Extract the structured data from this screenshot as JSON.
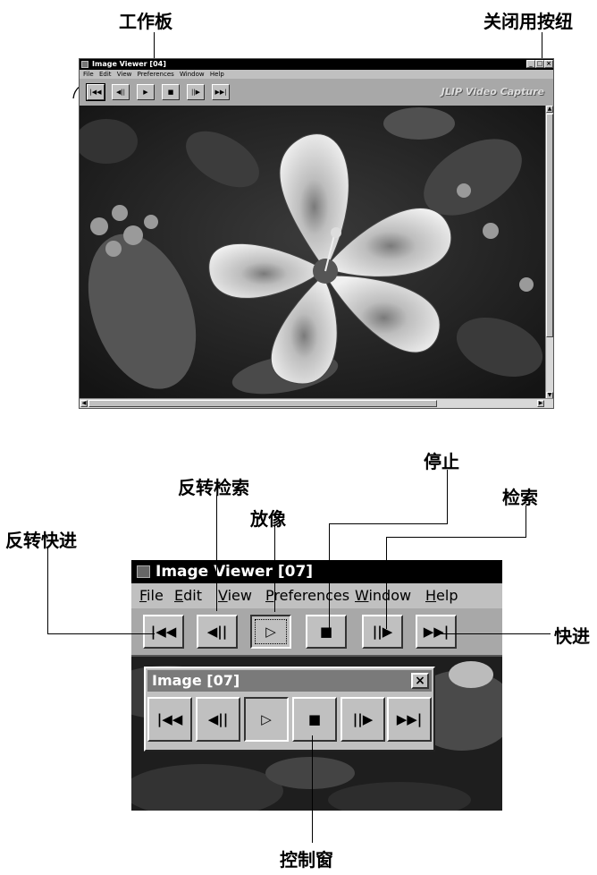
{
  "top_callouts": {
    "toolbar_label": "工作板",
    "close_button_label": "关闭用按纽"
  },
  "top_window": {
    "title": "Image Viewer [04]",
    "title_buttons": [
      "_",
      "□",
      "×"
    ],
    "menu": [
      "File",
      "Edit",
      "View",
      "Preferences",
      "Window",
      "Help"
    ],
    "buttons": [
      "|◀◀",
      "◀||",
      "▶",
      "■",
      "||▶",
      "▶▶|"
    ],
    "brand": "JLIP Video Capture"
  },
  "bottom_callouts": {
    "reverse_fast": "反转快进",
    "reverse_search": "反转检索",
    "play": "放像",
    "stop": "停止",
    "search": "检索",
    "fast_forward": "快进",
    "control_window": "控制窗"
  },
  "bottom_window": {
    "title": "Image Viewer [07]",
    "menu": [
      "File",
      "Edit",
      "View",
      "Preferences",
      "Window",
      "Help"
    ],
    "buttons": [
      "|◀◀",
      "◀||",
      "▷",
      "■",
      "||▶",
      "▶▶|"
    ]
  },
  "control_window": {
    "title": "Image [07]",
    "close": "×",
    "buttons": [
      "|◀◀",
      "◀||",
      "▷",
      "■",
      "||▶",
      "▶▶|"
    ]
  },
  "colors": {
    "titlebar": "#000000",
    "toolbar": "#a8a8a8",
    "button_face": "#c0c0c0",
    "control_title": "#7a7a7a"
  }
}
